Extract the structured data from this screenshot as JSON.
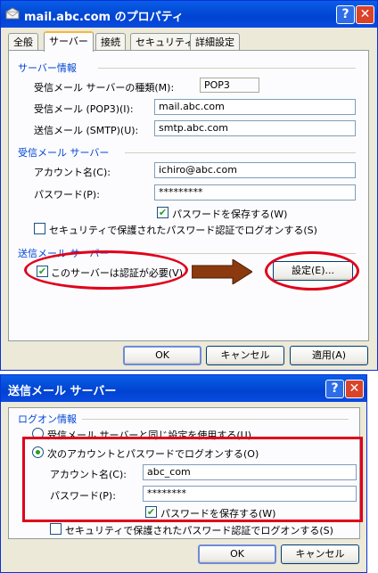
{
  "dialog1": {
    "title": "mail.abc.com のプロパティ",
    "tabs": [
      "全般",
      "サーバー",
      "接続",
      "セキュリティ",
      "詳細設定"
    ],
    "server_info": {
      "group": "サーバー情報",
      "incoming_type_label": "受信メール サーバーの種類(M):",
      "incoming_type_value": "POP3",
      "incoming_label": "受信メール (POP3)(I):",
      "incoming_value": "mail.abc.com",
      "outgoing_label": "送信メール (SMTP)(U):",
      "outgoing_value": "smtp.abc.com"
    },
    "incoming_server": {
      "group": "受信メール サーバー",
      "account_label": "アカウント名(C):",
      "account_value": "ichiro@abc.com",
      "password_label": "パスワード(P):",
      "password_value": "*********",
      "remember_password": "パスワードを保存する(W)",
      "spa_logon": "セキュリティで保護されたパスワード認証でログオンする(S)"
    },
    "outgoing_server": {
      "group": "送信メール サーバー",
      "auth_required": "このサーバーは認証が必要(V)",
      "settings_button": "設定(E)..."
    },
    "buttons": {
      "ok": "OK",
      "cancel": "キャンセル",
      "apply": "適用(A)"
    }
  },
  "dialog2": {
    "title": "送信メール サーバー",
    "group": "ログオン情報",
    "use_same": "受信メール サーバーと同じ設定を使用する(U)",
    "logon_with": "次のアカウントとパスワードでログオンする(O)",
    "account_label": "アカウント名(C):",
    "account_value": "abc_com",
    "password_label": "パスワード(P):",
    "password_value": "********",
    "remember_password": "パスワードを保存する(W)",
    "spa_logon": "セキュリティで保護されたパスワード認証でログオンする(S)",
    "buttons": {
      "ok": "OK",
      "cancel": "キャンセル"
    }
  },
  "colors": {
    "title_bar": "#0054e3",
    "annotation_red": "#e0001b",
    "arrow_brown": "#8b3a0f",
    "group_label": "#0046d5"
  },
  "icons": {
    "help": "?",
    "close": "✕",
    "check": "✔"
  }
}
